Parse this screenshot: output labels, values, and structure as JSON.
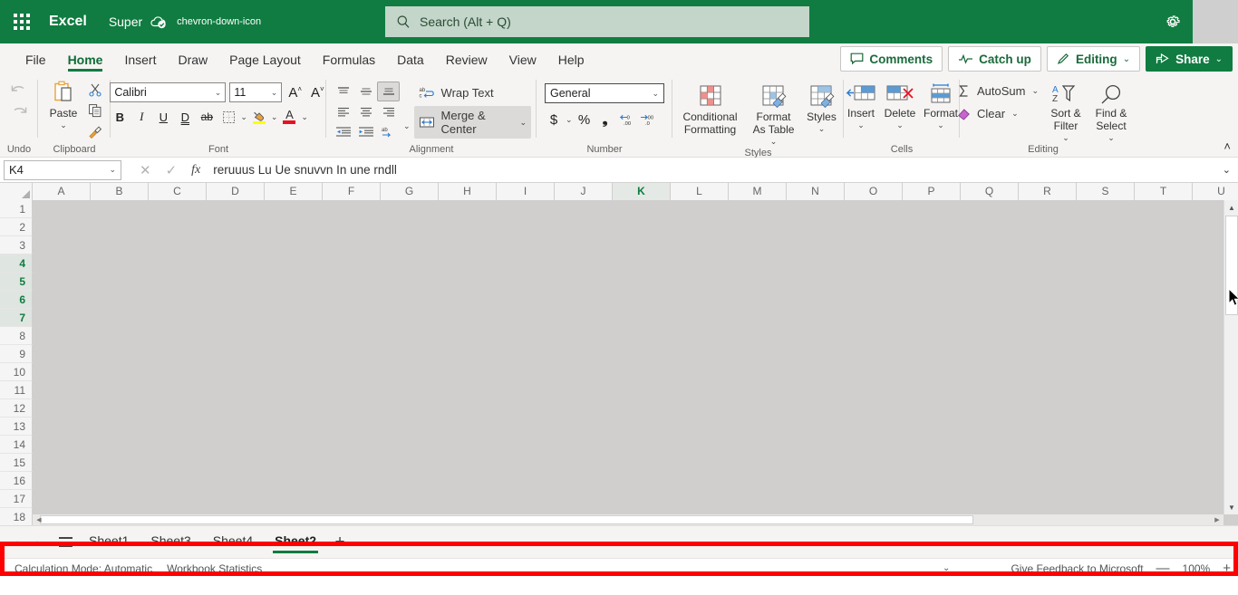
{
  "titlebar": {
    "waffle_icon": "app-launcher-icon",
    "app_name": "Excel",
    "doc_name": "Super",
    "cloud_icon": "cloud-saved-icon",
    "chevron_icon": "chevron-down-icon",
    "gear_icon": "gear-icon"
  },
  "search": {
    "icon": "search-icon",
    "placeholder": "Search (Alt + Q)"
  },
  "ribbon_tabs": [
    {
      "label": "File",
      "active": false
    },
    {
      "label": "Home",
      "active": true
    },
    {
      "label": "Insert",
      "active": false
    },
    {
      "label": "Draw",
      "active": false
    },
    {
      "label": "Page Layout",
      "active": false
    },
    {
      "label": "Formulas",
      "active": false
    },
    {
      "label": "Data",
      "active": false
    },
    {
      "label": "Review",
      "active": false
    },
    {
      "label": "View",
      "active": false
    },
    {
      "label": "Help",
      "active": false
    }
  ],
  "tab_right_buttons": [
    {
      "label": "Comments",
      "icon": "comment-icon",
      "style": "white"
    },
    {
      "label": "Catch up",
      "icon": "activity-icon",
      "style": "white"
    },
    {
      "label": "Editing",
      "icon": "pencil-icon",
      "style": "white",
      "chevron": "⌄"
    },
    {
      "label": "Share",
      "icon": "share-icon",
      "style": "green",
      "chevron": "⌄"
    }
  ],
  "ribbon": {
    "undo": {
      "label": "Undo",
      "undo_icon": "undo-arrow-icon",
      "redo_icon": "redo-arrow-icon"
    },
    "clipboard": {
      "label": "Clipboard",
      "paste_label": "Paste",
      "paste_icon": "clipboard-paste-icon",
      "cut_icon": "scissors-icon",
      "copy_icon": "copy-icon",
      "format_painter_icon": "format-painter-icon",
      "chevron": "⌄"
    },
    "font": {
      "label": "Font",
      "family_value": "Calibri",
      "size_value": "11",
      "grow_font_icon": "increase-font-size-icon",
      "shrink_font_icon": "decrease-font-size-icon",
      "bold": "B",
      "italic": "I",
      "underline": "U",
      "double_underline": "D",
      "strikethrough": "ab",
      "borders_icon": "borders-icon",
      "fill_color_icon": "fill-color-icon",
      "font_color_icon": "font-color-icon",
      "chevron": "⌄"
    },
    "alignment": {
      "label": "Alignment",
      "wrap_text_label": "Wrap Text",
      "wrap_text_icon": "wrap-text-icon",
      "merge_center_label": "Merge & Center",
      "merge_center_icon": "merge-cells-icon",
      "align_top_icon": "align-top-icon",
      "align_middle_icon": "align-middle-icon",
      "align_bottom_icon": "align-bottom-icon",
      "align_left_icon": "align-left-icon",
      "align_center_icon": "align-center-icon",
      "align_right_icon": "align-right-icon",
      "decrease_indent_icon": "decrease-indent-icon",
      "increase_indent_icon": "increase-indent-icon",
      "orientation_icon": "text-orientation-icon",
      "chevron": "⌄"
    },
    "number": {
      "label": "Number",
      "format_value": "General",
      "currency_icon": "dollar-icon",
      "percent_icon": "percent-icon",
      "comma_icon": "comma-style-icon",
      "decrease_decimal_icon": "decrease-decimal-icon",
      "increase_decimal_icon": "increase-decimal-icon",
      "chevron": "⌄"
    },
    "styles": {
      "label": "Styles",
      "items": [
        {
          "label": "Conditional Formatting",
          "icon": "conditional-formatting-icon",
          "chevron": "⌄"
        },
        {
          "label": "Format As Table",
          "icon": "format-as-table-icon",
          "chevron": "⌄"
        },
        {
          "label": "Styles",
          "icon": "cell-styles-icon",
          "chevron": "⌄"
        }
      ]
    },
    "cells": {
      "label": "Cells",
      "items": [
        {
          "label": "Insert",
          "icon": "insert-cells-icon",
          "chevron": "⌄"
        },
        {
          "label": "Delete",
          "icon": "delete-cells-icon",
          "chevron": "⌄"
        },
        {
          "label": "Format",
          "icon": "format-cells-icon",
          "chevron": "⌄"
        }
      ]
    },
    "editing": {
      "label": "Editing",
      "autosum_label": "AutoSum",
      "autosum_icon": "sigma-icon",
      "clear_label": "Clear",
      "clear_icon": "eraser-icon",
      "sort_filter_label": "Sort & Filter",
      "sort_filter_icon": "sort-filter-icon",
      "find_select_label": "Find & Select",
      "find_select_icon": "magnifier-icon",
      "chevron": "⌄",
      "collapse_icon": "chevron-up-icon"
    }
  },
  "formula_bar": {
    "name_box_value": "K4",
    "name_box_chevron": "⌄",
    "cancel_icon": "cancel-x-icon",
    "enter_icon": "check-icon",
    "fx_icon": "fx-icon",
    "formula_value": "reruuus Lu Ue snuvvn In une rndll",
    "expand_chevron": "⌄"
  },
  "grid": {
    "select_all_icon": "select-all-corner-icon",
    "columns": [
      "A",
      "B",
      "C",
      "D",
      "E",
      "F",
      "G",
      "H",
      "I",
      "J",
      "K",
      "L",
      "M",
      "N",
      "O",
      "P",
      "Q",
      "R",
      "S",
      "T",
      "U"
    ],
    "highlighted_columns": [
      "K"
    ],
    "rows": [
      "1",
      "2",
      "3",
      "4",
      "5",
      "6",
      "7",
      "8",
      "9",
      "10",
      "11",
      "12",
      "13",
      "14",
      "15",
      "16",
      "17",
      "18"
    ],
    "highlighted_rows": [
      "4",
      "5",
      "6",
      "7"
    ],
    "scroll_up_icon": "scroll-up-arrow-icon",
    "scroll_down_icon": "scroll-down-arrow-icon",
    "scroll_left_icon": "scroll-left-arrow-icon",
    "scroll_right_icon": "scroll-right-arrow-icon"
  },
  "sheet_bar": {
    "prev_icon": "chevron-left-icon",
    "next_icon": "chevron-right-icon",
    "all_sheets_icon": "sheet-list-icon",
    "tabs": [
      {
        "label": "Sheet1",
        "active": false
      },
      {
        "label": "Sheet3",
        "active": false
      },
      {
        "label": "Sheet4",
        "active": false
      },
      {
        "label": "Sheet2",
        "active": true
      }
    ],
    "add_sheet_label": "+"
  },
  "status_bar": {
    "calculation_mode": "Calculation Mode: Automatic",
    "workbook_statistics": "Workbook Statistics",
    "chevron": "⌄",
    "feedback": "Give Feedback to Microsoft",
    "zoom_out": "—",
    "zoom_level": "100%",
    "zoom_in": "+"
  },
  "colors": {
    "brand_green": "#107C41",
    "ribbon_bg": "#F5F4F2",
    "grid_fill": "#d0cfce",
    "annotation_red": "#ff0000",
    "search_bg": "#C3D6C9"
  }
}
